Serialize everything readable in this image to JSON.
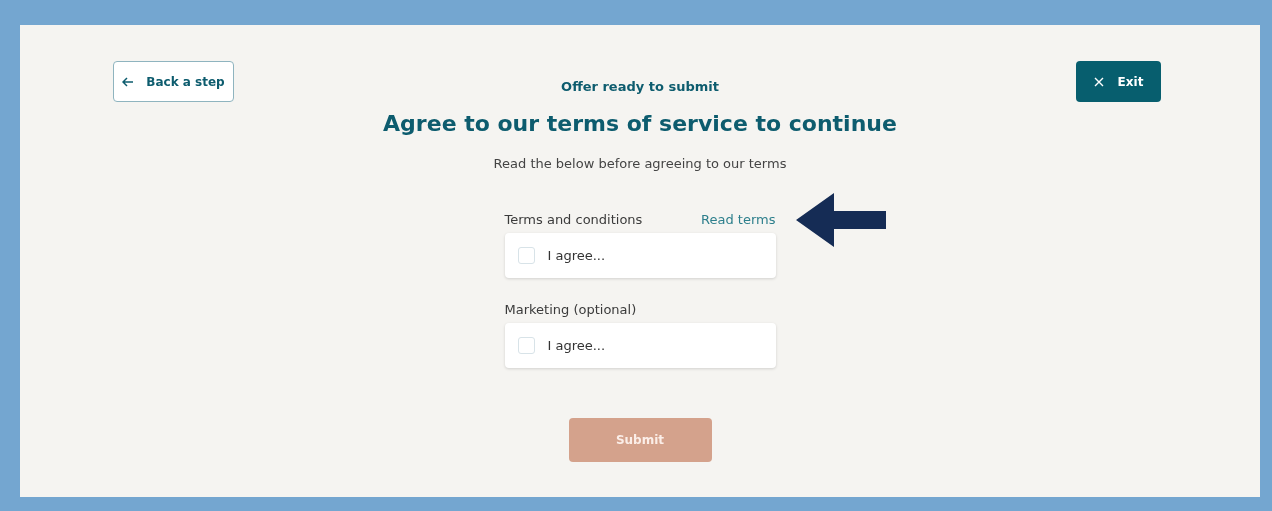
{
  "back_button": {
    "label": "Back a step"
  },
  "exit_button": {
    "label": "Exit"
  },
  "eyebrow": "Offer ready to submit",
  "heading": "Agree to our terms of service to continue",
  "subtitle": "Read the below before agreeing to our terms",
  "agreements": [
    {
      "label": "Terms and conditions",
      "link": "Read terms",
      "option": "I agree...",
      "checked": false
    },
    {
      "label": "Marketing (optional)",
      "option": "I agree...",
      "checked": false
    }
  ],
  "submit_button": {
    "label": "Submit",
    "disabled": true
  }
}
